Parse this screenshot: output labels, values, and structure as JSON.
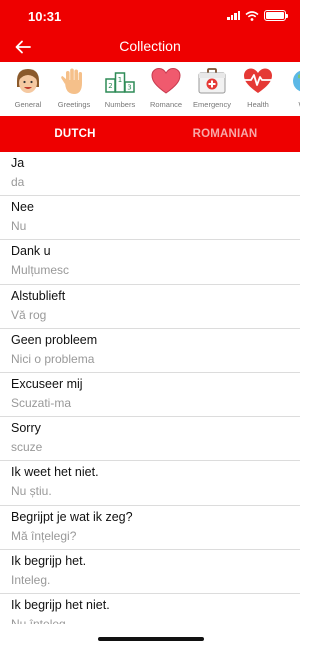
{
  "status_bar": {
    "time": "10:31"
  },
  "header": {
    "title": "Collection",
    "back_icon": "arrow-left-icon"
  },
  "categories": [
    {
      "label": "General",
      "icon": "smiling-face-icon"
    },
    {
      "label": "Greetings",
      "icon": "waving-hand-icon"
    },
    {
      "label": "Numbers",
      "icon": "numbers-podium-icon"
    },
    {
      "label": "Romance",
      "icon": "heart-icon"
    },
    {
      "label": "Emergency",
      "icon": "first-aid-kit-icon"
    },
    {
      "label": "Health",
      "icon": "heartbeat-icon"
    },
    {
      "label": "We",
      "icon": "globe-icon"
    }
  ],
  "tabs": [
    {
      "label": "DUTCH",
      "active": true
    },
    {
      "label": "ROMANIAN",
      "active": false
    }
  ],
  "phrases": [
    {
      "source": "Ja",
      "target": "da"
    },
    {
      "source": "Nee",
      "target": "Nu"
    },
    {
      "source": "Dank u",
      "target": "Mulțumesc"
    },
    {
      "source": "Alstublieft",
      "target": "Vă rog"
    },
    {
      "source": "Geen probleem",
      "target": "Nici o problema"
    },
    {
      "source": "Excuseer mij",
      "target": "Scuzati-ma"
    },
    {
      "source": "Sorry",
      "target": "scuze"
    },
    {
      "source": "Ik weet het niet.",
      "target": "Nu știu."
    },
    {
      "source": "Begrijpt je wat ik zeg?",
      "target": "Mă înțelegi?"
    },
    {
      "source": "Ik begrijp het.",
      "target": "Inteleg."
    },
    {
      "source": "Ik begrijp het niet.",
      "target": "Nu înțeleg."
    }
  ],
  "colors": {
    "accent": "#ee0000",
    "inactive_tab": "#f7a8a8",
    "secondary_text": "#999999"
  }
}
